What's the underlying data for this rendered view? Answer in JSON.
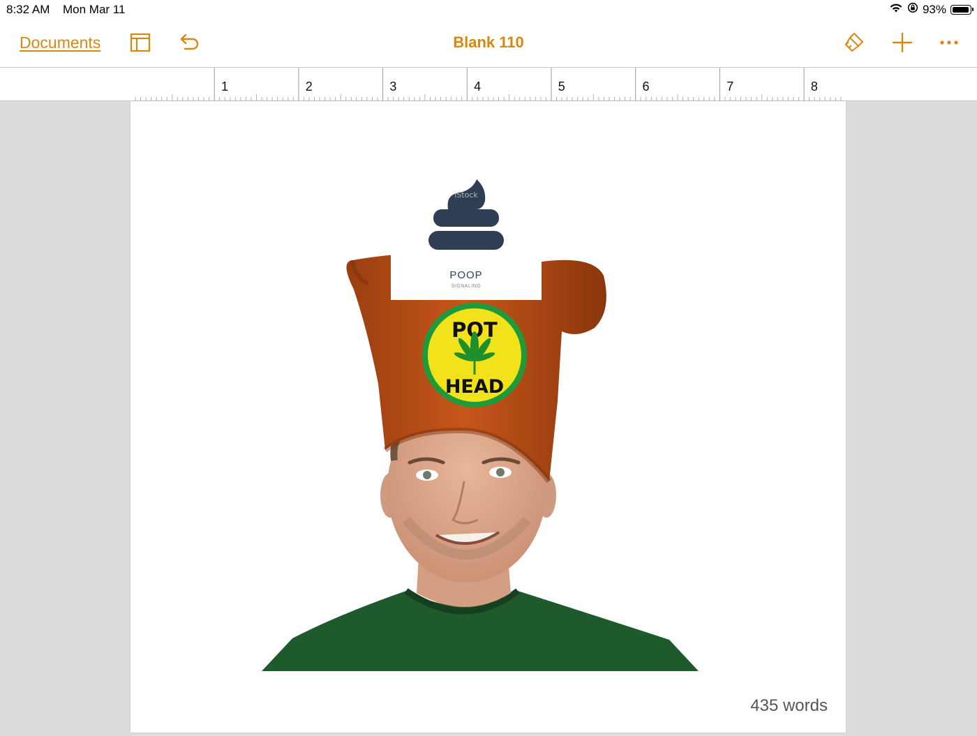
{
  "status_bar": {
    "time": "8:32 AM",
    "date": "Mon Mar 11",
    "battery_percent": "93%",
    "battery_level": 0.93
  },
  "toolbar": {
    "documents_label": "Documents",
    "document_title": "Blank 110",
    "accent_color": "#d9880f",
    "icons": [
      "sidebar-icon",
      "undo-icon",
      "paintbrush-icon",
      "plus-icon",
      "more-icon"
    ]
  },
  "ruler": {
    "labels": [
      "1",
      "2",
      "3",
      "4",
      "5",
      "6",
      "7",
      "8"
    ]
  },
  "image": {
    "badge_top": "POT",
    "badge_bottom": "HEAD",
    "sign_title": "POOP",
    "sign_subtitle": "SIGNALING",
    "watermark": "iStock"
  },
  "footer": {
    "word_count": "435 words"
  }
}
